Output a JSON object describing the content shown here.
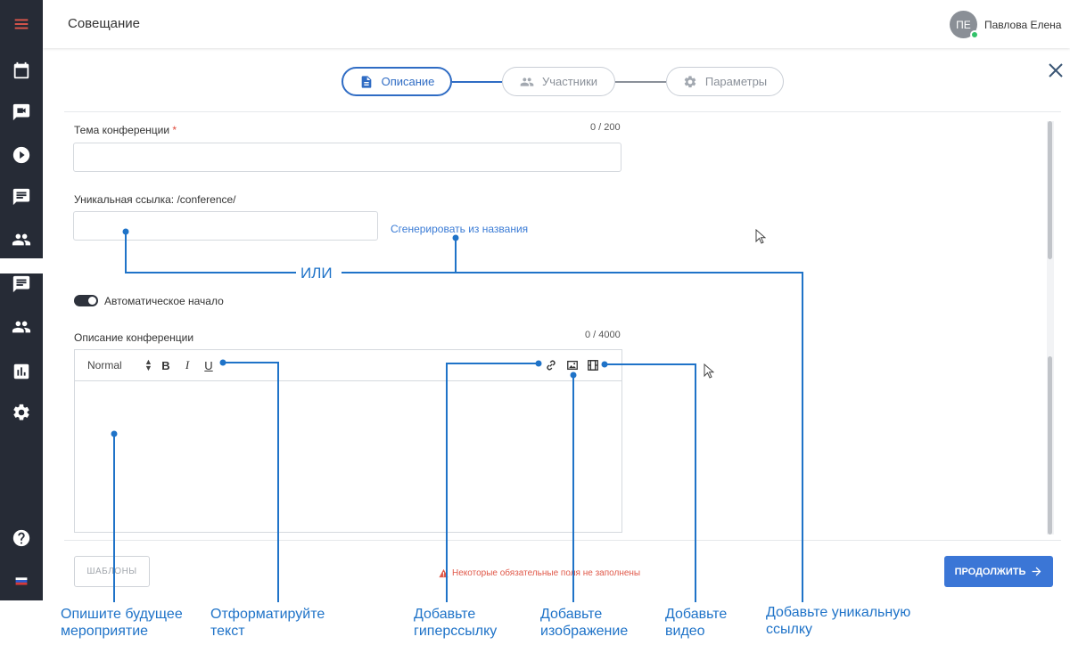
{
  "app": {
    "title": "Совещание"
  },
  "user": {
    "initials": "ПЕ",
    "name": "Павлова Елена"
  },
  "sidebar": {
    "items": [
      {
        "icon": "menu-icon"
      },
      {
        "icon": "calendar-icon"
      },
      {
        "icon": "video-chat-icon"
      },
      {
        "icon": "play-icon"
      },
      {
        "icon": "chat-icon"
      },
      {
        "icon": "people-icon"
      },
      {
        "icon": "chat-icon"
      },
      {
        "icon": "people-icon"
      },
      {
        "icon": "analytics-icon"
      },
      {
        "icon": "settings-icon"
      },
      {
        "icon": "help-icon"
      },
      {
        "icon": "language-flag-icon"
      }
    ]
  },
  "stepper": {
    "steps": [
      {
        "label": "Описание",
        "icon": "document-icon",
        "active": true
      },
      {
        "label": "Участники",
        "icon": "people-icon",
        "active": false
      },
      {
        "label": "Параметры",
        "icon": "gear-icon",
        "active": false
      }
    ]
  },
  "form": {
    "topic": {
      "label": "Тема конференции",
      "required_mark": "*",
      "counter": "0 / 200",
      "value": ""
    },
    "link": {
      "label": "Уникальная ссылка: /conference/",
      "value": "",
      "generate_label": "Сгенерировать из названия"
    },
    "auto_start": {
      "label": "Автоматическое начало",
      "enabled": true
    },
    "description": {
      "label": "Описание конференции",
      "counter": "0 / 4000",
      "toolbar": {
        "format": "Normal",
        "bold": "B",
        "italic": "I",
        "underline": "U"
      }
    }
  },
  "footer": {
    "templates_label": "ШАБЛОНЫ",
    "warning": "Некоторые обязательные поля не заполнены",
    "continue_label": "ПРОДОЛЖИТЬ"
  },
  "annotations": {
    "or": "ИЛИ",
    "describe": "Опишите будущее\nмероприятие",
    "format": "Отформатируйте\nтекст",
    "hyperlink": "Добавьте\nгиперссылку",
    "image": "Добавьте\nизображение",
    "video": "Добавьте\nвидео",
    "unique_link": "Добавьте уникальную\nссылку"
  },
  "colors": {
    "accent": "#2f6cc4",
    "sidebar": "#262b36",
    "annotation": "#1f73c8",
    "warning": "#e0594a"
  }
}
